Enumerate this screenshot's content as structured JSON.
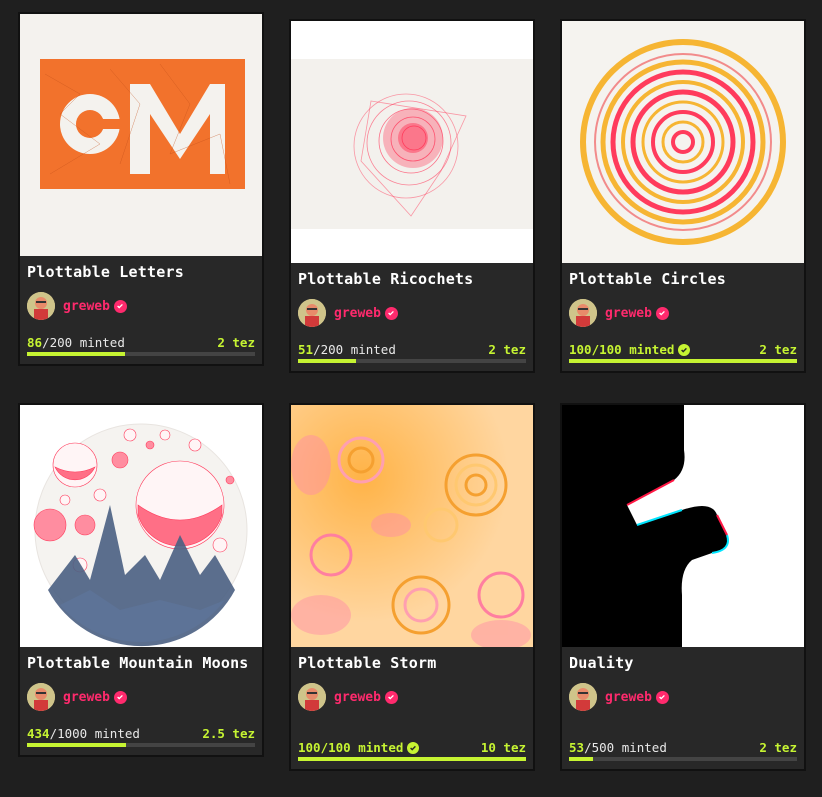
{
  "cards": [
    {
      "title": "Plottable Letters",
      "artist": "greweb",
      "minted": "86",
      "supply": "200",
      "minted_label": " minted",
      "price": "2 tez",
      "progress": 0.43,
      "sold_out": false
    },
    {
      "title": "Plottable Ricochets",
      "artist": "greweb",
      "minted": "51",
      "supply": "200",
      "minted_label": " minted",
      "price": "2 tez",
      "progress": 0.255,
      "sold_out": false
    },
    {
      "title": "Plottable Circles",
      "artist": "greweb",
      "minted": "100",
      "supply": "100",
      "minted_label": " minted",
      "price": "2 tez",
      "progress": 1.0,
      "sold_out": true
    },
    {
      "title": "Plottable Mountain Moons",
      "artist": "greweb",
      "minted": "434",
      "supply": "1000",
      "minted_label": " minted",
      "price": "2.5 tez",
      "progress": 0.434,
      "sold_out": false
    },
    {
      "title": "Plottable Storm",
      "artist": "greweb",
      "minted": "100",
      "supply": "100",
      "minted_label": " minted",
      "price": "10 tez",
      "progress": 1.0,
      "sold_out": true
    },
    {
      "title": "Duality",
      "artist": "greweb",
      "minted": "53",
      "supply": "500",
      "minted_label": " minted",
      "price": "2 tez",
      "progress": 0.106,
      "sold_out": false
    }
  ],
  "colors": {
    "accent": "#c6f432",
    "artist": "#ff2a6d",
    "card_bg": "#282828",
    "page_bg": "#1f1f1f"
  }
}
